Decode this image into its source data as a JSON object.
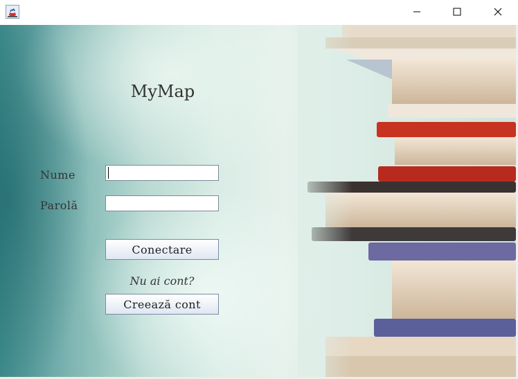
{
  "window": {
    "app_icon": "java-cup-icon",
    "controls": {
      "minimize": "minimize-icon",
      "maximize": "maximize-icon",
      "close": "close-icon"
    }
  },
  "login": {
    "title": "MyMap",
    "username_label": "Nume",
    "username_value": "",
    "password_label": "Parolă",
    "password_value": "",
    "login_button": "Conectare",
    "no_account_text": "Nu ai cont?",
    "create_account_button": "Creează cont"
  },
  "background": {
    "image": "stack-of-books-photo",
    "accent": "#7fb6b3"
  }
}
